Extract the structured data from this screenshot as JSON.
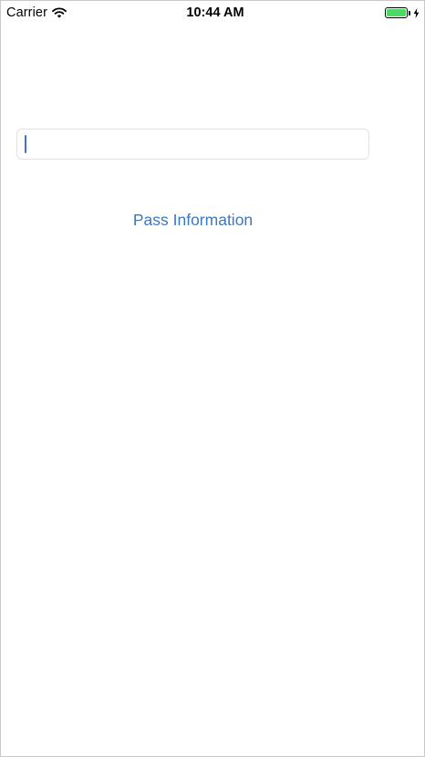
{
  "status_bar": {
    "carrier": "Carrier",
    "time": "10:44 AM",
    "wifi_icon": "wifi-icon",
    "battery_icon": "battery-icon",
    "charging_icon": "lightning-bolt-icon",
    "battery_level_percent": 100,
    "battery_fill_color": "#4cd964"
  },
  "main": {
    "text_field": {
      "value": "",
      "placeholder": "",
      "cursor_color": "#3f6fd4"
    },
    "pass_button": {
      "label": "Pass Information",
      "color": "#3b78c0"
    }
  }
}
